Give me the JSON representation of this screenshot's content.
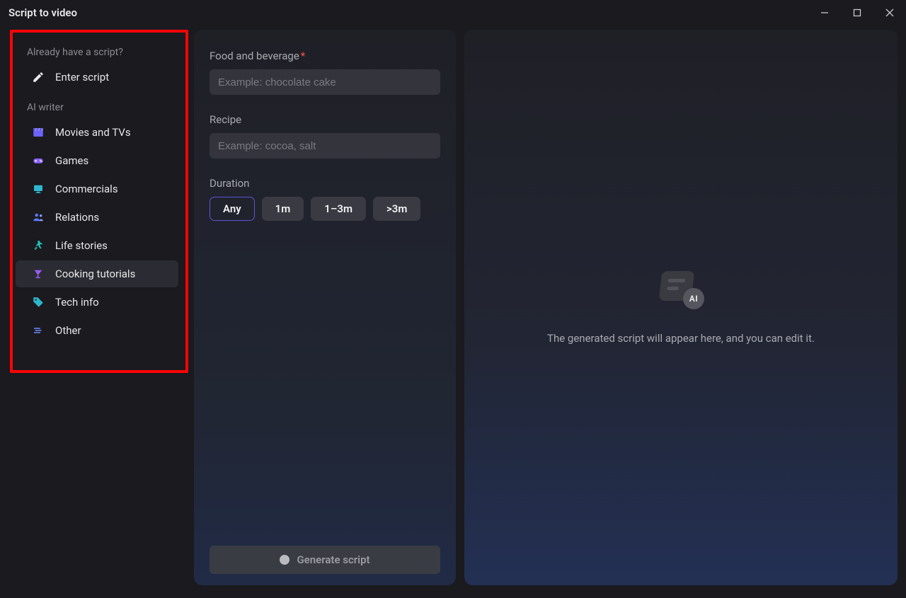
{
  "window": {
    "title": "Script to video"
  },
  "sidebar": {
    "section1_label": "Already have a script?",
    "enter_script_label": "Enter script",
    "section2_label": "AI writer",
    "items": [
      {
        "id": "movies",
        "label": "Movies and TVs"
      },
      {
        "id": "games",
        "label": "Games"
      },
      {
        "id": "commercials",
        "label": "Commercials"
      },
      {
        "id": "relations",
        "label": "Relations"
      },
      {
        "id": "life-stories",
        "label": "Life stories"
      },
      {
        "id": "cooking",
        "label": "Cooking tutorials",
        "selected": true
      },
      {
        "id": "tech-info",
        "label": "Tech info"
      },
      {
        "id": "other",
        "label": "Other"
      }
    ]
  },
  "form": {
    "food_label": "Food and beverage",
    "food_value": "",
    "food_placeholder": "Example: chocolate cake",
    "recipe_label": "Recipe",
    "recipe_value": "",
    "recipe_placeholder": "Example: cocoa, salt",
    "duration_label": "Duration",
    "duration_options": [
      {
        "id": "any",
        "label": "Any",
        "selected": true
      },
      {
        "id": "1m",
        "label": "1m"
      },
      {
        "id": "1-3m",
        "label": "1–3m"
      },
      {
        "id": "gt3m",
        "label": ">3m"
      }
    ],
    "generate_label": "Generate script"
  },
  "preview": {
    "ai_badge": "AI",
    "message": "The generated script will appear here, and you can edit it."
  }
}
